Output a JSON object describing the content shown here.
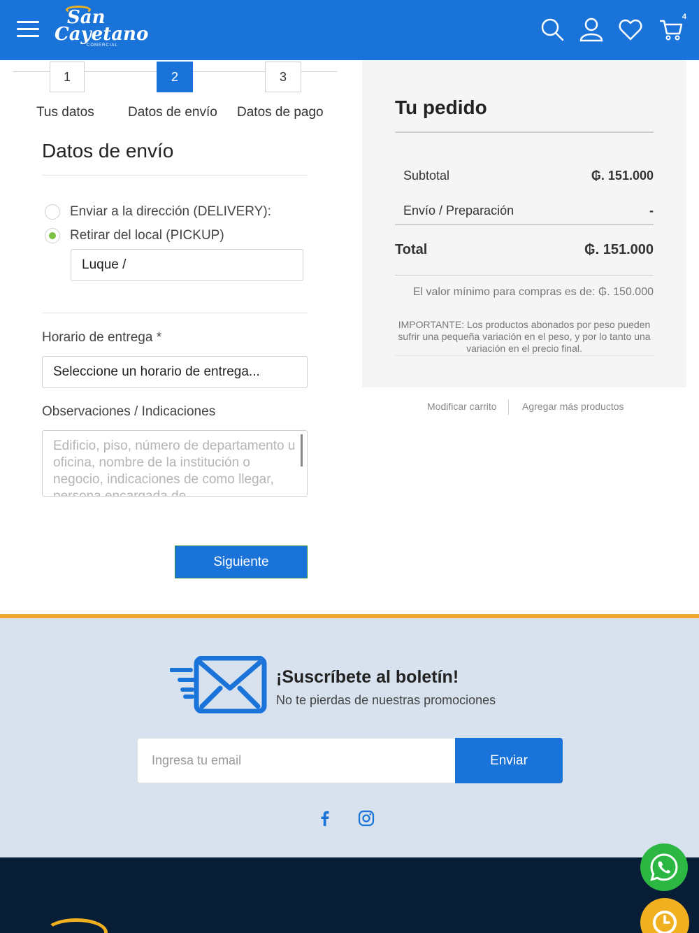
{
  "header": {
    "logo": {
      "line1": "San",
      "line2": "Cayetano",
      "sub": "COMERCIAL"
    },
    "cart_count": "4",
    "icons": [
      "menu-icon",
      "search-icon",
      "user-icon",
      "heart-icon",
      "cart-icon"
    ],
    "bg_color": "#1a73d9"
  },
  "steps": [
    {
      "number": "1",
      "label": "Tus datos"
    },
    {
      "number": "2",
      "label": "Datos de envío"
    },
    {
      "number": "3",
      "label": "Datos de pago"
    }
  ],
  "shipping": {
    "title": "Datos de envío",
    "option_delivery": "Enviar a la dirección (DELIVERY):",
    "option_pickup": "Retirar del local (PICKUP)",
    "pickup_location": "Luque /",
    "schedule_label": "Horario de entrega *",
    "schedule_value": "Seleccione un horario de entrega...",
    "notes_label": "Observaciones / Indicaciones",
    "notes_placeholder": "Edificio, piso, número de departamento u oficina, nombre de la institución o negocio, indicaciones de como llegar, persona encargada de",
    "next_button": "Siguiente"
  },
  "order": {
    "title": "Tu pedido",
    "subtotal_label": "Subtotal",
    "subtotal_value": "₲. 151.000",
    "shipping_label": "Envío / Preparación",
    "shipping_value": "-",
    "total_label": "Total",
    "total_value": "₲. 151.000",
    "min_note": "El valor mínimo para compras es de: ₲. 150.000",
    "important_note": "IMPORTANTE: Los productos abonados por peso pueden sufrir una pequeña variación en el peso, y por lo tanto una variación en el precio final.",
    "link_modify": "Modificar carrito",
    "link_add": "Agregar más productos"
  },
  "newsletter": {
    "title": "¡Suscríbete al boletín!",
    "subtitle": "No te pierdas de nuestras promociones",
    "email_placeholder": "Ingresa tu email",
    "send_button": "Enviar",
    "accent_color": "#f0a830"
  },
  "social": [
    "facebook-icon",
    "instagram-icon"
  ],
  "floating": [
    "whatsapp-icon",
    "clock-icon"
  ]
}
